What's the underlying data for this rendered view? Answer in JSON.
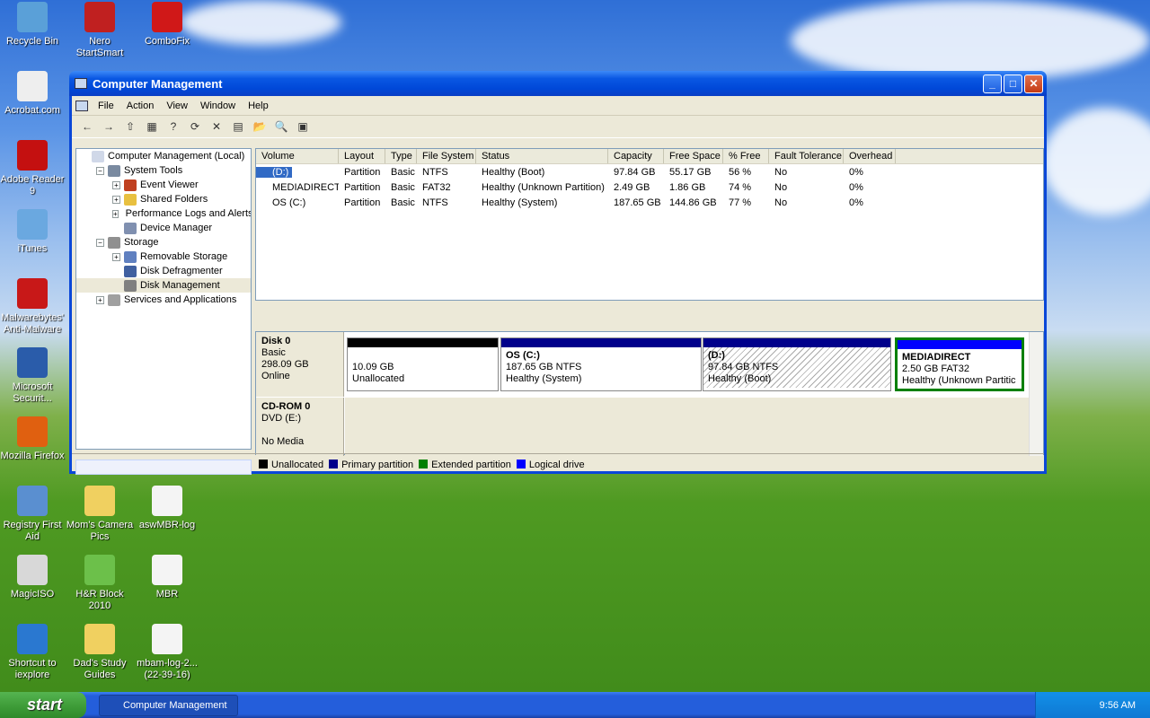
{
  "desktop": {
    "icons": [
      {
        "label": "Recycle Bin",
        "color": "#5aa0d8"
      },
      {
        "label": "Nero StartSmart",
        "color": "#c02020"
      },
      {
        "label": "ComboFix",
        "color": "#d01818"
      },
      {
        "label": "Acrobat.com",
        "color": "#eeeeee"
      },
      {
        "label": "Adobe Reader 9",
        "color": "#c41010"
      },
      {
        "label": "iTunes",
        "color": "#6aa8e0"
      },
      {
        "label": "Malwarebytes' Anti-Malware",
        "color": "#c81818"
      },
      {
        "label": "Microsoft Securit...",
        "color": "#2a5caa"
      },
      {
        "label": "Mozilla Firefox",
        "color": "#e06010"
      },
      {
        "label": "Registry First Aid",
        "color": "#5a8fd0"
      },
      {
        "label": "Mom's Camera Pics",
        "color": "#f0d060"
      },
      {
        "label": "aswMBR-log",
        "color": "#f4f4f4"
      },
      {
        "label": "MagicISO",
        "color": "#d8d8d8"
      },
      {
        "label": "H&R Block 2010",
        "color": "#6cc04a"
      },
      {
        "label": "MBR",
        "color": "#f4f4f4"
      },
      {
        "label": "Shortcut to iexplore",
        "color": "#2a78d0"
      },
      {
        "label": "Dad's Study Guides",
        "color": "#f0d060"
      },
      {
        "label": "mbam-log-2... (22-39-16)",
        "color": "#f4f4f4"
      }
    ]
  },
  "window": {
    "title": "Computer Management",
    "controls": {
      "minimize": "_",
      "maximize": "□",
      "close": "✕"
    }
  },
  "menu": [
    "File",
    "Action",
    "View",
    "Window",
    "Help"
  ],
  "toolbar": [
    "←",
    "→",
    "⇧",
    "▦",
    "?",
    "⟳",
    "✕",
    "▤",
    "📂",
    "🔍",
    "▣"
  ],
  "tree": [
    {
      "label": "Computer Management (Local)",
      "level": 0,
      "exp": ""
    },
    {
      "label": "System Tools",
      "level": 1,
      "exp": "−"
    },
    {
      "label": "Event Viewer",
      "level": 2,
      "exp": "+"
    },
    {
      "label": "Shared Folders",
      "level": 2,
      "exp": "+"
    },
    {
      "label": "Performance Logs and Alerts",
      "level": 2,
      "exp": "+"
    },
    {
      "label": "Device Manager",
      "level": 2,
      "exp": ""
    },
    {
      "label": "Storage",
      "level": 1,
      "exp": "−"
    },
    {
      "label": "Removable Storage",
      "level": 2,
      "exp": "+"
    },
    {
      "label": "Disk Defragmenter",
      "level": 2,
      "exp": ""
    },
    {
      "label": "Disk Management",
      "level": 2,
      "exp": ""
    },
    {
      "label": "Services and Applications",
      "level": 1,
      "exp": "+"
    }
  ],
  "volumes": {
    "headers": [
      "Volume",
      "Layout",
      "Type",
      "File System",
      "Status",
      "Capacity",
      "Free Space",
      "% Free",
      "Fault Tolerance",
      "Overhead"
    ],
    "rows": [
      [
        "(D:)",
        "Partition",
        "Basic",
        "NTFS",
        "Healthy (Boot)",
        "97.84 GB",
        "55.17 GB",
        "56 %",
        "No",
        "0%"
      ],
      [
        "MEDIADIRECT",
        "Partition",
        "Basic",
        "FAT32",
        "Healthy (Unknown Partition)",
        "2.49 GB",
        "1.86 GB",
        "74 %",
        "No",
        "0%"
      ],
      [
        "OS (C:)",
        "Partition",
        "Basic",
        "NTFS",
        "Healthy (System)",
        "187.65 GB",
        "144.86 GB",
        "77 %",
        "No",
        "0%"
      ]
    ]
  },
  "disks": {
    "disk0": {
      "name": "Disk 0",
      "type": "Basic",
      "size": "298.09 GB",
      "state": "Online"
    },
    "cdrom": {
      "name": "CD-ROM 0",
      "type": "DVD (E:)",
      "state": "No Media"
    },
    "partitions": [
      {
        "title": "",
        "line1": "10.09 GB",
        "line2": "Unallocated",
        "color": "#000000"
      },
      {
        "title": "OS  (C:)",
        "line1": "187.65 GB NTFS",
        "line2": "Healthy (System)",
        "color": "#00008b"
      },
      {
        "title": "(D:)",
        "line1": "97.84 GB NTFS",
        "line2": "Healthy (Boot)",
        "color": "#00008b"
      },
      {
        "title": "MEDIADIRECT",
        "line1": "2.50 GB FAT32",
        "line2": "Healthy (Unknown Partitic",
        "color": "#0000ff"
      }
    ]
  },
  "legend": [
    {
      "label": "Unallocated",
      "color": "#000000"
    },
    {
      "label": "Primary partition",
      "color": "#00008b"
    },
    {
      "label": "Extended partition",
      "color": "#008000"
    },
    {
      "label": "Logical drive",
      "color": "#0000ff"
    }
  ],
  "taskbar": {
    "start": "start",
    "task": "Computer Management",
    "time": "9:56 AM"
  }
}
